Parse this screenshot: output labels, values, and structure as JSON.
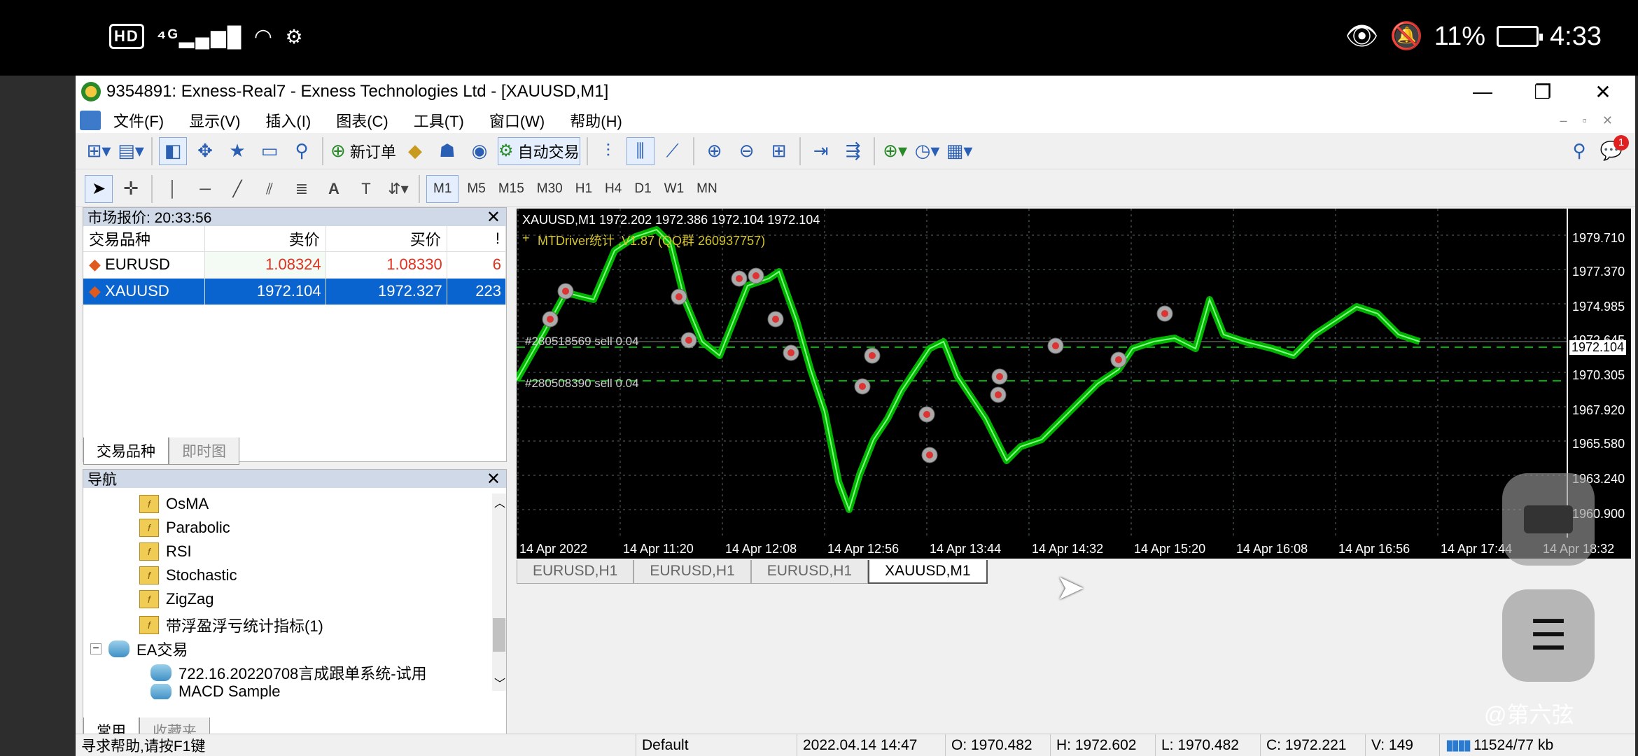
{
  "phone": {
    "left_status": "HD 4G",
    "battery": "11%",
    "time": "4:33"
  },
  "window": {
    "title": "9354891: Exness-Real7 - Exness Technologies Ltd - [XAUUSD,M1]"
  },
  "menu": [
    "文件(F)",
    "显示(V)",
    "插入(I)",
    "图表(C)",
    "工具(T)",
    "窗口(W)",
    "帮助(H)"
  ],
  "toolbar": {
    "new_order": "新订单",
    "auto_trade": "自动交易",
    "notification_count": "1"
  },
  "timeframes": [
    "M1",
    "M5",
    "M15",
    "M30",
    "H1",
    "H4",
    "D1",
    "W1",
    "MN"
  ],
  "market_watch": {
    "title": "市场报价: 20:33:56",
    "columns": [
      "交易品种",
      "卖价",
      "买价",
      "!"
    ],
    "rows": [
      {
        "symbol": "EURUSD",
        "bid": "1.08324",
        "ask": "1.08330",
        "spread": "6"
      },
      {
        "symbol": "XAUUSD",
        "bid": "1972.104",
        "ask": "1972.327",
        "spread": "223"
      }
    ],
    "tabs": [
      "交易品种",
      "即时图"
    ]
  },
  "navigator": {
    "title": "导航",
    "items": [
      "OsMA",
      "Parabolic",
      "RSI",
      "Stochastic",
      "ZigZag",
      "带浮盈浮亏统计指标(1)",
      "EA交易",
      "722.16.20220708言成跟单系统-试用",
      "MACD Sample"
    ],
    "tabs": [
      "常用",
      "收藏夹"
    ]
  },
  "chart": {
    "header": "XAUUSD,M1  1972.202 1972.386 1972.104 1972.104",
    "indicator": "MTDriver统计 ,V1.87 (QQ群 260937757)",
    "order1": "#280518569 sell 0.04",
    "order2": "#280508390 sell 0.04",
    "current_price": "1972.104",
    "price_labels": [
      "1979.710",
      "1977.370",
      "1974.985",
      "1972.645",
      "1970.305",
      "1967.920",
      "1965.580",
      "1963.240",
      "1960.900"
    ],
    "time_labels": [
      "14 Apr 2022",
      "14 Apr 11:20",
      "14 Apr 12:08",
      "14 Apr 12:56",
      "14 Apr 13:44",
      "14 Apr 14:32",
      "14 Apr 15:20",
      "14 Apr 16:08",
      "14 Apr 16:56",
      "14 Apr 17:44",
      "14 Apr 18:32"
    ],
    "tabs": [
      "EURUSD,H1",
      "EURUSD,H1",
      "EURUSD,H1",
      "XAUUSD,M1"
    ],
    "colors": {
      "bg": "#000000",
      "candles": "#00c800",
      "grid": "#5a6a6a",
      "level": "#00b000"
    }
  },
  "statusbar": {
    "help": "寻求帮助,请按F1键",
    "profile": "Default",
    "datetime": "2022.04.14 14:47",
    "open": "O: 1970.482",
    "high": "H: 1972.602",
    "low": "L: 1970.482",
    "close": "C: 1972.221",
    "volume": "V: 149",
    "traffic": "11524/77 kb"
  },
  "watermark": "@第六弦"
}
